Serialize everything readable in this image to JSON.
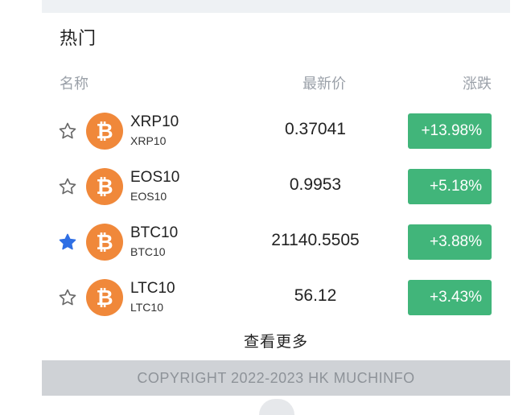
{
  "section": {
    "title": "热门"
  },
  "columns": {
    "name": "名称",
    "price": "最新价",
    "change": "涨跌"
  },
  "rows": [
    {
      "symbol": "XRP10",
      "sub": "XRP10",
      "price": "0.37041",
      "change": "+13.98%",
      "starred": false
    },
    {
      "symbol": "EOS10",
      "sub": "EOS10",
      "price": "0.9953",
      "change": "+5.18%",
      "starred": false
    },
    {
      "symbol": "BTC10",
      "sub": "BTC10",
      "price": "21140.5505",
      "change": "+3.88%",
      "starred": true
    },
    {
      "symbol": "LTC10",
      "sub": "LTC10",
      "price": "56.12",
      "change": "+3.43%",
      "starred": false
    }
  ],
  "more_label": "查看更多",
  "footer": {
    "copyright": "COPYRIGHT 2022-2023 HK MUCHINFO"
  },
  "colors": {
    "up": "#41b57a",
    "coin": "#f0883a",
    "star_active": "#2f6fe4",
    "star_inactive": "#666666"
  },
  "icons": {
    "star": "star-icon",
    "coin": "bitcoin-icon"
  }
}
